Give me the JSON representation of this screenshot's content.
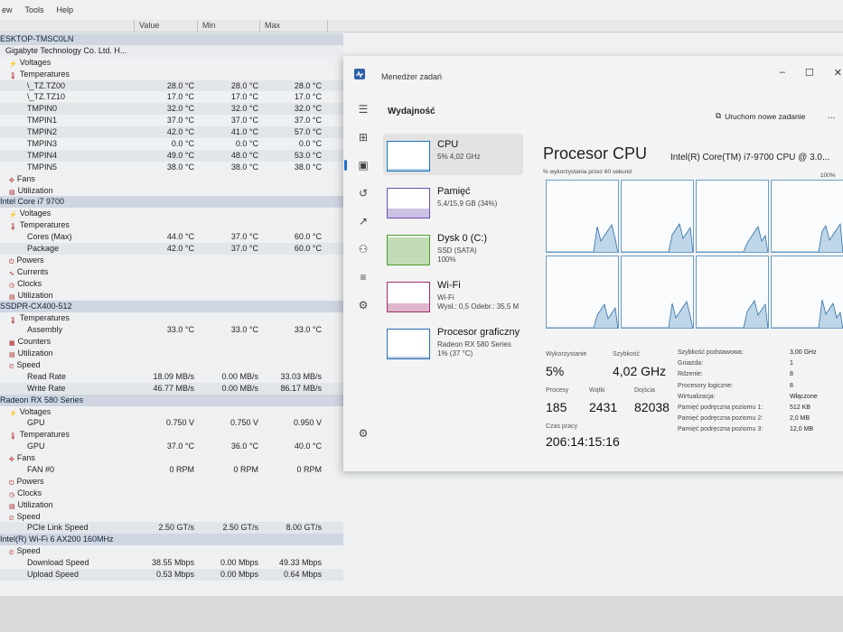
{
  "hwmonitor": {
    "menu": [
      "ew",
      "Tools",
      "Help"
    ],
    "columns": {
      "value": "Value",
      "min": "Min",
      "max": "Max"
    },
    "rows": [
      {
        "t": "dev",
        "name": "ESKTOP-TMSC0LN"
      },
      {
        "t": "sub",
        "name": "Gigabyte Technology Co. Ltd. H..."
      },
      {
        "t": "grp",
        "name": "Voltages",
        "icon": "voltage-icon"
      },
      {
        "t": "grp",
        "name": "Temperatures",
        "icon": "thermometer-icon"
      },
      {
        "t": "leaf",
        "name": "\\_TZ.TZ00",
        "v": "28.0 °C",
        "min": "28.0 °C",
        "max": "28.0 °C"
      },
      {
        "t": "leaf",
        "name": "\\_TZ.TZ10",
        "v": "17.0 °C",
        "min": "17.0 °C",
        "max": "17.0 °C"
      },
      {
        "t": "leaf",
        "name": "TMPIN0",
        "v": "32.0 °C",
        "min": "32.0 °C",
        "max": "32.0 °C"
      },
      {
        "t": "leaf",
        "name": "TMPIN1",
        "v": "37.0 °C",
        "min": "37.0 °C",
        "max": "37.0 °C"
      },
      {
        "t": "leaf",
        "name": "TMPIN2",
        "v": "42.0 °C",
        "min": "41.0 °C",
        "max": "57.0 °C"
      },
      {
        "t": "leaf",
        "name": "TMPIN3",
        "v": "0.0 °C",
        "min": "0.0 °C",
        "max": "0.0 °C"
      },
      {
        "t": "leaf",
        "name": "TMPIN4",
        "v": "49.0 °C",
        "min": "48.0 °C",
        "max": "53.0 °C"
      },
      {
        "t": "leaf",
        "name": "TMPIN5",
        "v": "38.0 °C",
        "min": "38.0 °C",
        "max": "38.0 °C"
      },
      {
        "t": "grp",
        "name": "Fans",
        "icon": "fan-icon"
      },
      {
        "t": "grp",
        "name": "Utilization",
        "icon": "utilization-icon"
      },
      {
        "t": "dev",
        "name": "Intel Core i7 9700"
      },
      {
        "t": "grp",
        "name": "Voltages",
        "icon": "voltage-icon"
      },
      {
        "t": "grp",
        "name": "Temperatures",
        "icon": "thermometer-icon"
      },
      {
        "t": "leaf",
        "name": "Cores (Max)",
        "v": "44.0 °C",
        "min": "37.0 °C",
        "max": "60.0 °C"
      },
      {
        "t": "leaf",
        "name": "Package",
        "v": "42.0 °C",
        "min": "37.0 °C",
        "max": "60.0 °C"
      },
      {
        "t": "grp",
        "name": "Powers",
        "icon": "power-icon"
      },
      {
        "t": "grp",
        "name": "Currents",
        "icon": "current-icon"
      },
      {
        "t": "grp",
        "name": "Clocks",
        "icon": "clock-icon"
      },
      {
        "t": "grp",
        "name": "Utilization",
        "icon": "utilization-icon"
      },
      {
        "t": "dev",
        "name": "SSDPR-CX400-512"
      },
      {
        "t": "grp",
        "name": "Temperatures",
        "icon": "thermometer-icon"
      },
      {
        "t": "leaf",
        "name": "Assembly",
        "v": "33.0 °C",
        "min": "33.0 °C",
        "max": "33.0 °C"
      },
      {
        "t": "grp",
        "name": "Counters",
        "icon": "counter-icon"
      },
      {
        "t": "grp",
        "name": "Utilization",
        "icon": "utilization-icon"
      },
      {
        "t": "grp",
        "name": "Speed",
        "icon": "speed-icon"
      },
      {
        "t": "leaf",
        "name": "Read Rate",
        "v": "18.09 MB/s",
        "min": "0.00 MB/s",
        "max": "33.03 MB/s"
      },
      {
        "t": "leaf",
        "name": "Write Rate",
        "v": "46.77 MB/s",
        "min": "0.00 MB/s",
        "max": "86.17 MB/s"
      },
      {
        "t": "dev",
        "name": "Radeon RX 580 Series"
      },
      {
        "t": "grp",
        "name": "Voltages",
        "icon": "voltage-icon"
      },
      {
        "t": "leaf",
        "name": "GPU",
        "v": "0.750 V",
        "min": "0.750 V",
        "max": "0.950 V"
      },
      {
        "t": "grp",
        "name": "Temperatures",
        "icon": "thermometer-icon"
      },
      {
        "t": "leaf",
        "name": "GPU",
        "v": "37.0 °C",
        "min": "36.0 °C",
        "max": "40.0 °C"
      },
      {
        "t": "grp",
        "name": "Fans",
        "icon": "fan-icon"
      },
      {
        "t": "leaf",
        "name": "FAN #0",
        "v": "0 RPM",
        "min": "0 RPM",
        "max": "0 RPM"
      },
      {
        "t": "grp",
        "name": "Powers",
        "icon": "power-icon"
      },
      {
        "t": "grp",
        "name": "Clocks",
        "icon": "clock-icon"
      },
      {
        "t": "grp",
        "name": "Utilization",
        "icon": "utilization-icon"
      },
      {
        "t": "grp",
        "name": "Speed",
        "icon": "speed-icon"
      },
      {
        "t": "leaf",
        "name": "PCIe Link Speed",
        "v": "2.50 GT/s",
        "min": "2.50 GT/s",
        "max": "8.00 GT/s"
      },
      {
        "t": "dev",
        "name": "Intel(R) Wi-Fi 6 AX200 160MHz"
      },
      {
        "t": "grp",
        "name": "Speed",
        "icon": "speed-icon"
      },
      {
        "t": "leaf",
        "name": "Download Speed",
        "v": "38.55 Mbps",
        "min": "0.00 Mbps",
        "max": "49.33 Mbps"
      },
      {
        "t": "leaf",
        "name": "Upload Speed",
        "v": "0.53 Mbps",
        "min": "0.00 Mbps",
        "max": "0.64 Mbps"
      }
    ]
  },
  "taskmanager": {
    "title": "Menedżer zadań",
    "section": "Wydajność",
    "run_task": "Uruchom nowe zadanie",
    "more": "...",
    "nav_icons": [
      "menu-icon",
      "processes-icon",
      "performance-icon",
      "history-icon",
      "startup-icon",
      "users-icon",
      "details-icon",
      "services-icon",
      "settings-icon"
    ],
    "perf_items": [
      {
        "name": "CPU",
        "line1": "5% 4,02 GHz",
        "line2": "",
        "color": "#1a73b8",
        "fill": 0.05
      },
      {
        "name": "Pamięć",
        "line1": "5,4/15,9 GB (34%)",
        "line2": "",
        "color": "#6b4db2",
        "fill": 0.34
      },
      {
        "name": "Dysk 0 (C:)",
        "line1": "SSD (SATA)",
        "line2": "100%",
        "color": "#4c9a2a",
        "fill": 1.0
      },
      {
        "name": "Wi-Fi",
        "line1": "Wi-Fi",
        "line2": "Wysł.: 0,5 Odebr.: 35,5 M",
        "color": "#a0306a",
        "fill": 0.3
      },
      {
        "name": "Procesor graficzny",
        "line1": "Radeon RX 580 Series",
        "line2": "1% (37 °C)",
        "color": "#2a6fb5",
        "fill": 0.01
      }
    ],
    "cpu": {
      "title": "Procesor CPU",
      "model": "Intel(R) Core(TM) i7-9700 CPU @ 3.0...",
      "subtitle": "% wykorzystania przez 60 sekund",
      "max_label": "100%",
      "stats": {
        "util_label": "Wykorzystanie",
        "util": "5%",
        "speed_label": "Szybkość",
        "speed": "4,02 GHz",
        "proc_label": "Procesy",
        "proc": "185",
        "threads_label": "Wątki",
        "threads": "2431",
        "handles_label": "Dojścia",
        "handles": "82038",
        "uptime_label": "Czas pracy",
        "uptime": "206:14:15:16"
      },
      "details": [
        {
          "k": "Szybkość podstawowa:",
          "v": "3,00 GHz"
        },
        {
          "k": "Gniazda:",
          "v": "1"
        },
        {
          "k": "Rdzenie:",
          "v": "8"
        },
        {
          "k": "Procesory logiczne:",
          "v": "8"
        },
        {
          "k": "Wirtualizacja:",
          "v": "Włączone"
        },
        {
          "k": "Pamięć podręczna poziomu 1:",
          "v": "512 KB"
        },
        {
          "k": "Pamięć podręczna poziomu 2:",
          "v": "2,0 MB"
        },
        {
          "k": "Pamięć podręczna poziomu 3:",
          "v": "12,0 MB"
        }
      ],
      "cores": 8
    }
  }
}
